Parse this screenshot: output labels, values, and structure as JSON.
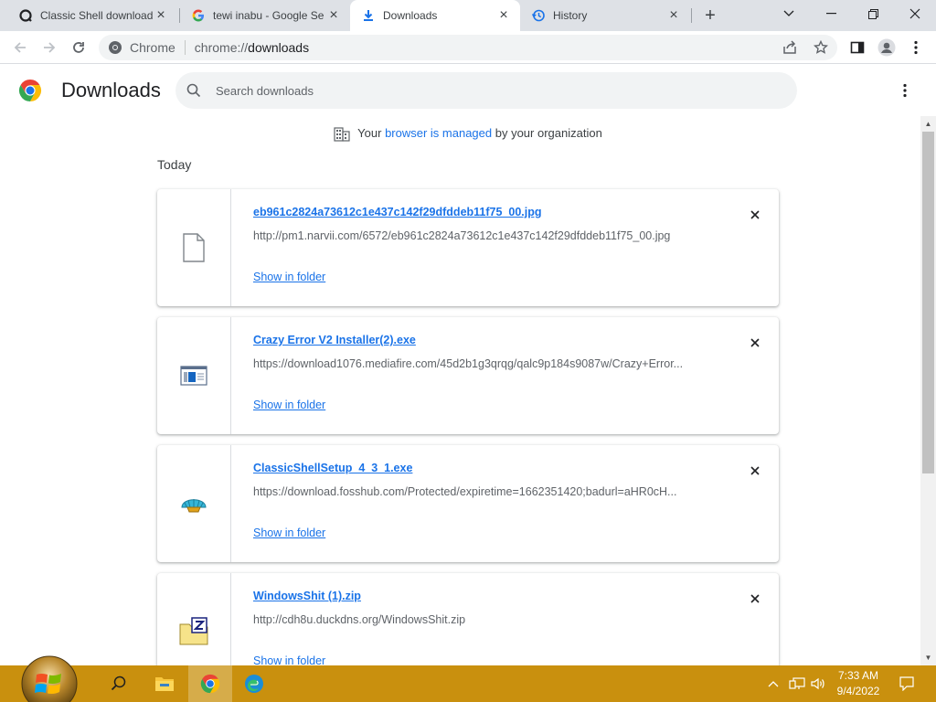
{
  "tabs": [
    {
      "title": "Classic Shell download",
      "icon": "classic-shell-icon",
      "active": false
    },
    {
      "title": "tewi inabu - Google Se",
      "icon": "google-icon",
      "active": false
    },
    {
      "title": "Downloads",
      "icon": "download-icon",
      "active": true
    },
    {
      "title": "History",
      "icon": "history-icon",
      "active": false
    }
  ],
  "omnibox": {
    "chip_label": "Chrome",
    "url_scheme": "chrome://",
    "url_host": "downloads"
  },
  "page": {
    "title": "Downloads",
    "search_placeholder": "Search downloads"
  },
  "managed": {
    "before": "Your ",
    "link": "browser is managed",
    "after": " by your organization"
  },
  "section_label": "Today",
  "downloads": [
    {
      "filename": "eb961c2824a73612c1e437c142f29dfddeb11f75_00.jpg",
      "url": "http://pm1.narvii.com/6572/eb961c2824a73612c1e437c142f29dfddeb11f75_00.jpg",
      "action": "Show in folder",
      "icon": "generic-file-icon"
    },
    {
      "filename": "Crazy Error V2 Installer(2).exe",
      "url": "https://download1076.mediafire.com/45d2b1g3qrqg/qalc9p184s9087w/Crazy+Error...",
      "action": "Show in folder",
      "icon": "exe-window-icon"
    },
    {
      "filename": "ClassicShellSetup_4_3_1.exe",
      "url": "https://download.fosshub.com/Protected/expiretime=1662351420;badurl=aHR0cH...",
      "action": "Show in folder",
      "icon": "seashell-icon"
    },
    {
      "filename": "WindowsShit (1).zip",
      "url": "http://cdh8u.duckdns.org/WindowsShit.zip",
      "action": "Show in folder",
      "icon": "zip-folder-icon"
    }
  ],
  "clock": {
    "time": "7:33 AM",
    "date": "9/4/2022"
  },
  "colors": {
    "link": "#1a73e8",
    "taskbar": "#c9900e",
    "tabstrip": "#dee1e6"
  }
}
